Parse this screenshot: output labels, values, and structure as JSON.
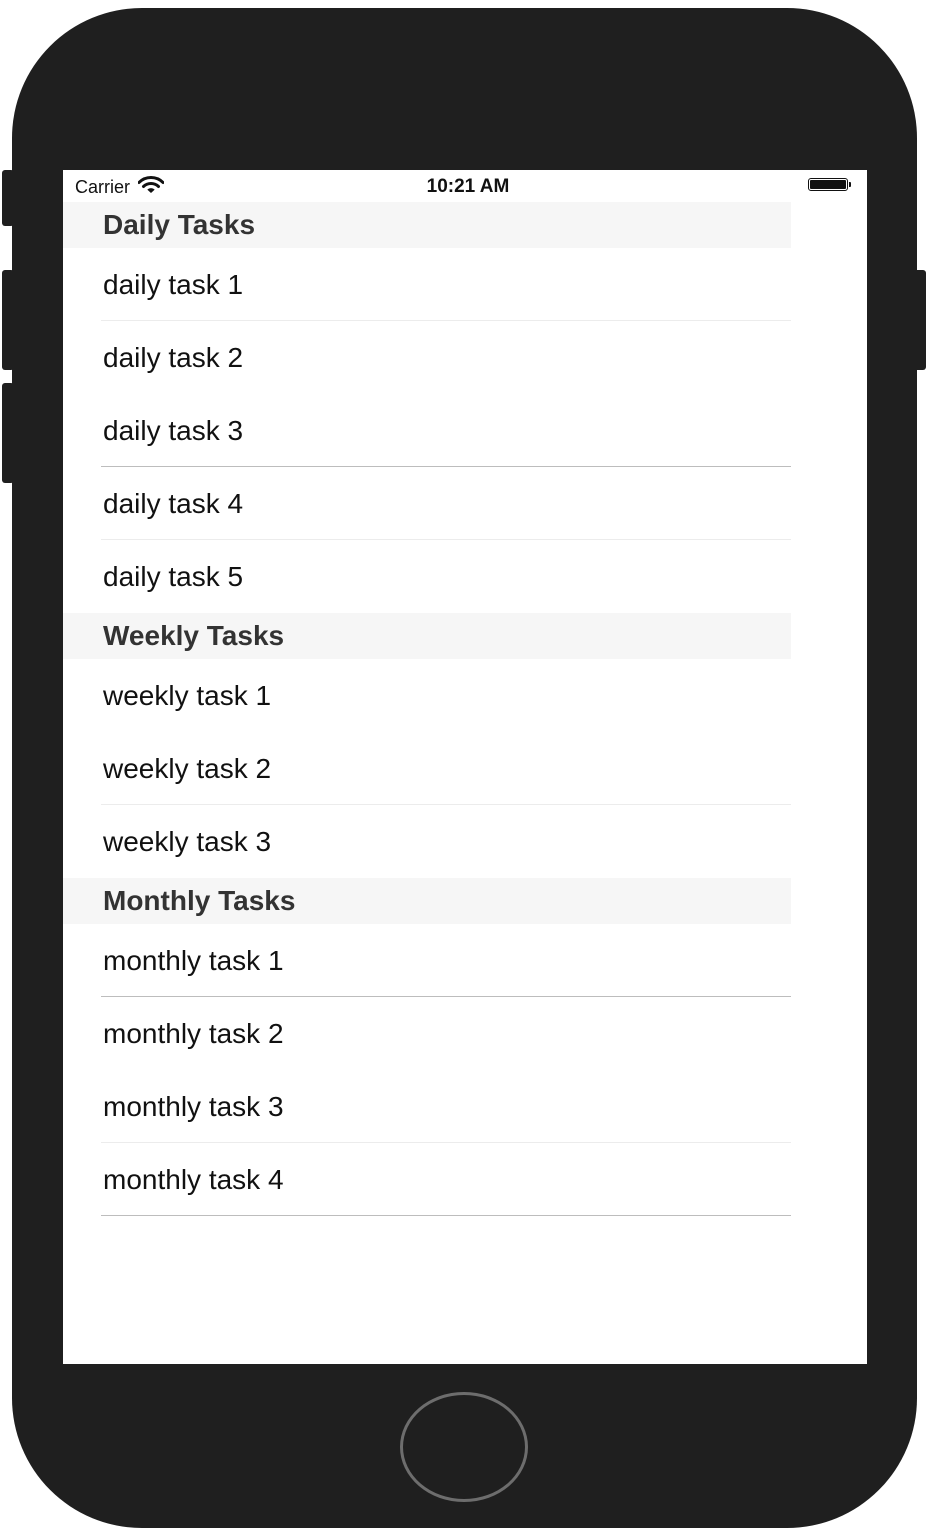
{
  "status_bar": {
    "carrier": "Carrier",
    "time": "10:21 AM"
  },
  "sections": [
    {
      "title": "Daily Tasks",
      "items": [
        "daily task 1",
        "daily task 2",
        "daily task 3",
        "daily task 4",
        "daily task 5"
      ]
    },
    {
      "title": "Weekly Tasks",
      "items": [
        "weekly task 1",
        "weekly task 2",
        "weekly task 3"
      ]
    },
    {
      "title": "Monthly Tasks",
      "items": [
        "monthly task 1",
        "monthly task 2",
        "monthly task 3",
        "monthly task 4"
      ]
    }
  ],
  "icons": {
    "wifi": "wifi-icon",
    "battery": "battery-icon",
    "home": "home-button"
  },
  "colors": {
    "device_frame": "#1f1f1f",
    "section_header_bg": "#f6f6f6",
    "separator": "#ececec"
  }
}
